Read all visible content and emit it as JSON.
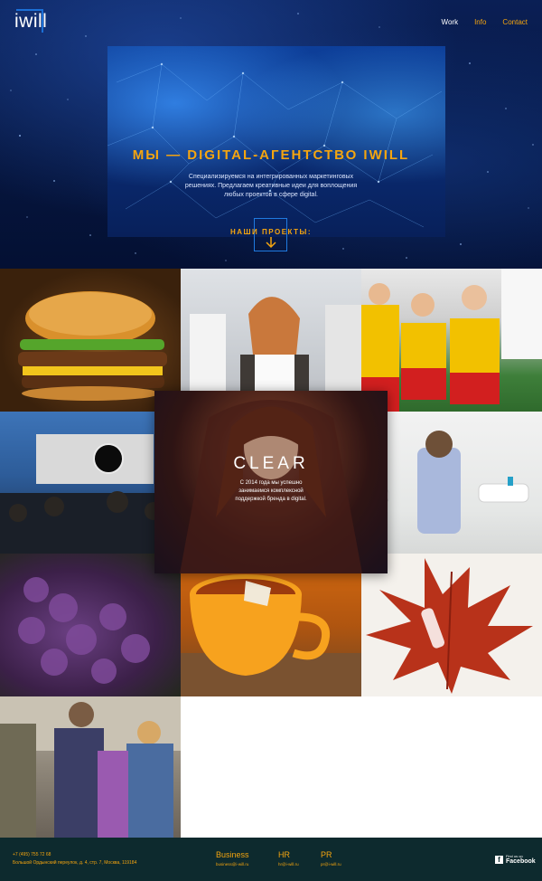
{
  "brand": {
    "logo": "iwill"
  },
  "nav": {
    "items": [
      "Work",
      "Info",
      "Contact"
    ],
    "active": "Work"
  },
  "hero": {
    "title": "МЫ — DIGITAL-АГЕНТСТВО IWILL",
    "text": "Специализируемся на интегрированных маркетинговых решениях. Предлагаем креативные идеи для воплощения любых проектов в сфере digital.",
    "projects_label": "НАШИ ПРОЕКТЫ:"
  },
  "featured": {
    "title": "CLEAR",
    "text": "С 2014 года мы успешно занимаемся комплексной поддержкой бренда в digital."
  },
  "footer": {
    "phone": "+7 (495) 755 72 68",
    "address": "Большой Ордынский переулок, д. 4, стр. 7, Москва, 119184",
    "contacts": [
      {
        "title": "Business",
        "email": "business@i-will.ru"
      },
      {
        "title": "HR",
        "email": "hr@i-will.ru"
      },
      {
        "title": "PR",
        "email": "pr@i-will.ru"
      }
    ],
    "facebook": {
      "line1": "Find us on",
      "line2": "Facebook"
    }
  },
  "colors": {
    "accent": "#f5a50f",
    "hero_dark": "#06163f",
    "footer_bg": "#0d2a2e"
  }
}
